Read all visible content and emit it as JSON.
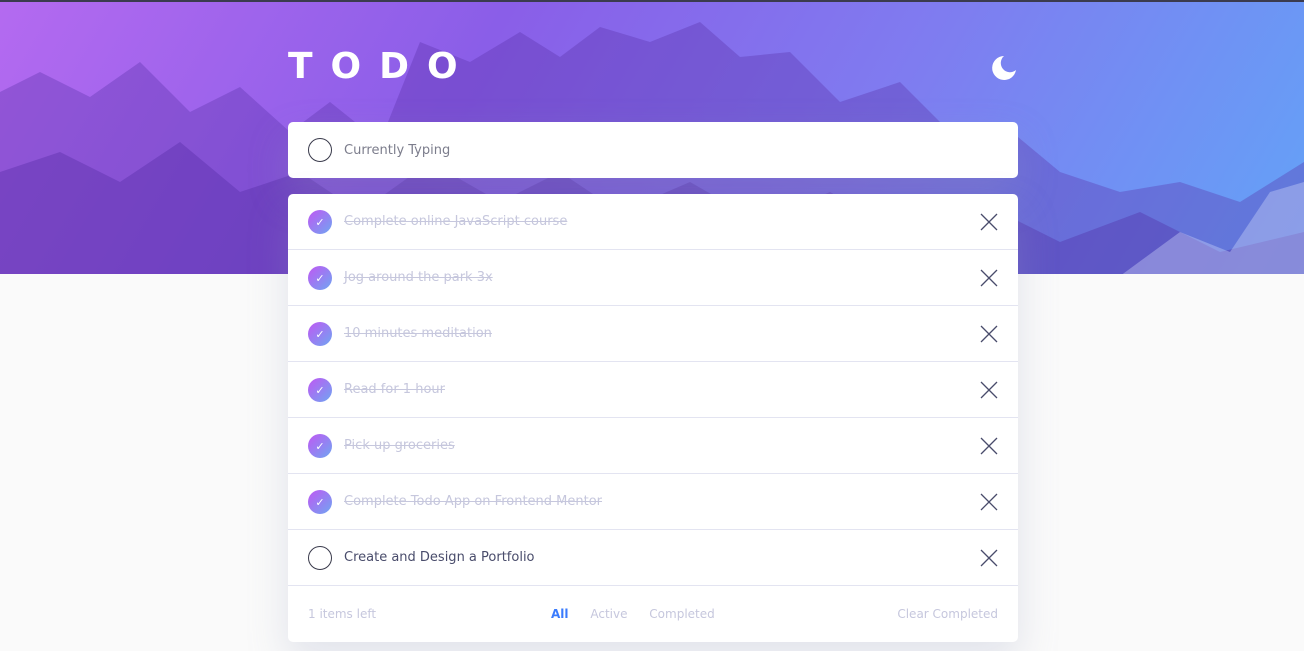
{
  "app": {
    "title": "TODO"
  },
  "colors": {
    "accent": "#3a7bfd",
    "check_gradient_start": "#c058f3",
    "check_gradient_end": "#6fa6f2",
    "completed_text": "#c6c7dd",
    "active_text": "#494c6b"
  },
  "header": {
    "theme_icon": "moon-icon"
  },
  "new_todo": {
    "placeholder": "Currently Typing"
  },
  "todos": [
    {
      "text": "Complete online JavaScript course",
      "completed": true
    },
    {
      "text": "Jog around the park 3x",
      "completed": true
    },
    {
      "text": "10 minutes meditation",
      "completed": true
    },
    {
      "text": "Read for 1 hour",
      "completed": true
    },
    {
      "text": "Pick up groceries",
      "completed": true
    },
    {
      "text": "Complete Todo App on Frontend Mentor",
      "completed": true
    },
    {
      "text": "Create and Design a Portfolio",
      "completed": false
    }
  ],
  "footer": {
    "items_left": "1 items left",
    "filters": [
      "All",
      "Active",
      "Completed"
    ],
    "active_filter": "All",
    "clear_label": "Clear Completed"
  }
}
